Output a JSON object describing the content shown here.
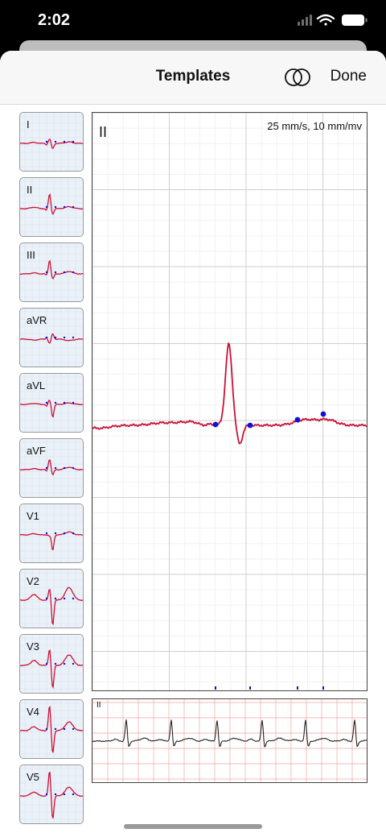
{
  "status_bar": {
    "time": "2:02",
    "icons": [
      "cellular-signal-icon",
      "wifi-icon",
      "battery-icon"
    ]
  },
  "nav": {
    "title": "Templates",
    "overlay_icon": "overlapping-circles-icon",
    "done_label": "Done"
  },
  "leads": [
    {
      "label": "I"
    },
    {
      "label": "II"
    },
    {
      "label": "III"
    },
    {
      "label": "aVR"
    },
    {
      "label": "aVL"
    },
    {
      "label": "aVF"
    },
    {
      "label": "V1"
    },
    {
      "label": "V2"
    },
    {
      "label": "V3"
    },
    {
      "label": "V4"
    },
    {
      "label": "V5"
    }
  ],
  "main_plot": {
    "lead": "II",
    "scale": "25 mm/s, 10 mm/mv"
  },
  "rhythm_strip": {
    "lead": "II"
  },
  "colors": {
    "trace": "#cc1036",
    "marker": "#1010dd",
    "thumb_bg": "#eaf1f8",
    "rhythm_grid": "#f0a5a5",
    "rhythm_trace": "#222222"
  }
}
